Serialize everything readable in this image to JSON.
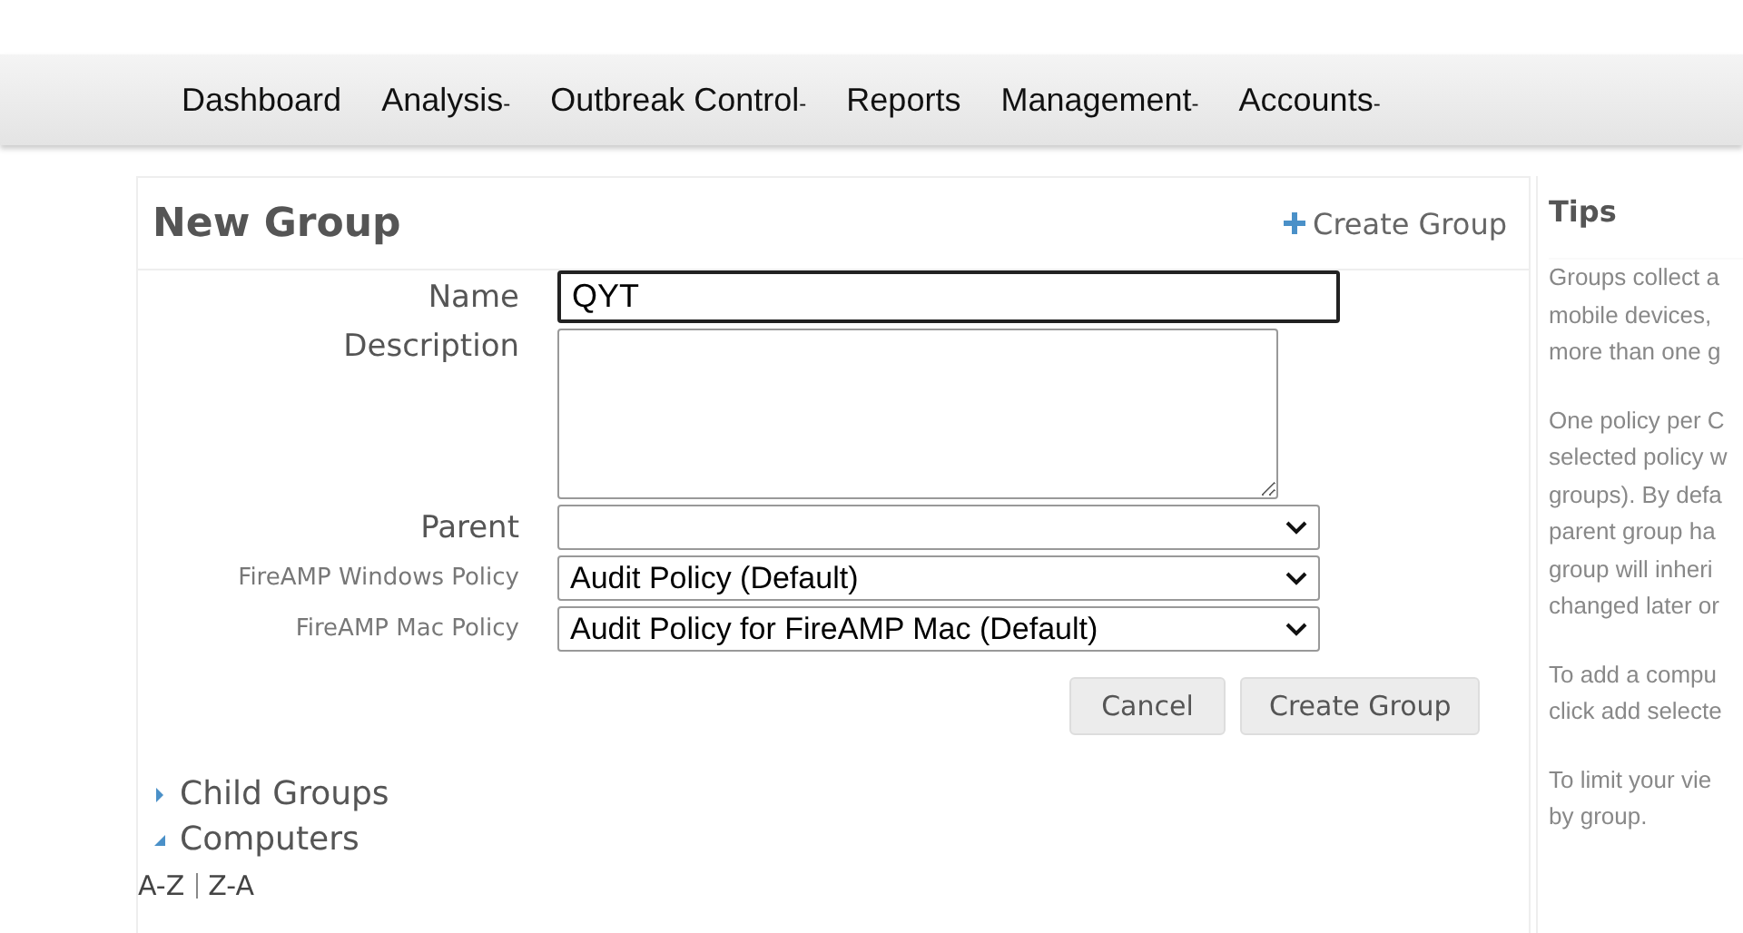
{
  "nav": [
    {
      "label": "Dashboard"
    },
    {
      "label": "Analysis",
      "caret": "-"
    },
    {
      "label": "Outbreak Control",
      "caret": "-"
    },
    {
      "label": "Reports"
    },
    {
      "label": "Management",
      "caret": "-"
    },
    {
      "label": "Accounts",
      "caret": "-"
    }
  ],
  "panel": {
    "title": "New Group",
    "header_link": "Create Group"
  },
  "form": {
    "name_label": "Name",
    "name_value": "QYT",
    "description_label": "Description",
    "parent_label": "Parent",
    "windows_policy_label": "FireAMP Windows Policy",
    "windows_policy_value": "Audit Policy (Default)",
    "mac_policy_label": "FireAMP Mac Policy",
    "mac_policy_value": "Audit Policy for FireAMP Mac (Default)"
  },
  "buttons": [
    "Cancel",
    "Create Group"
  ],
  "sections": [
    {
      "label": "Child Groups",
      "expanded": false
    },
    {
      "label": "Computers",
      "expanded": true
    }
  ],
  "sort_links": [
    "A-Z",
    "Z-A"
  ],
  "tips": {
    "title": "Tips",
    "paragraphs": [
      "Groups collect a\nmobile devices,\nmore than one g",
      "One policy per C\nselected policy w\ngroups). By defa\nparent group ha\ngroup will inheri\nchanged later or",
      "To add a compu\nclick add selecte",
      "To limit your vie\nby group."
    ]
  }
}
